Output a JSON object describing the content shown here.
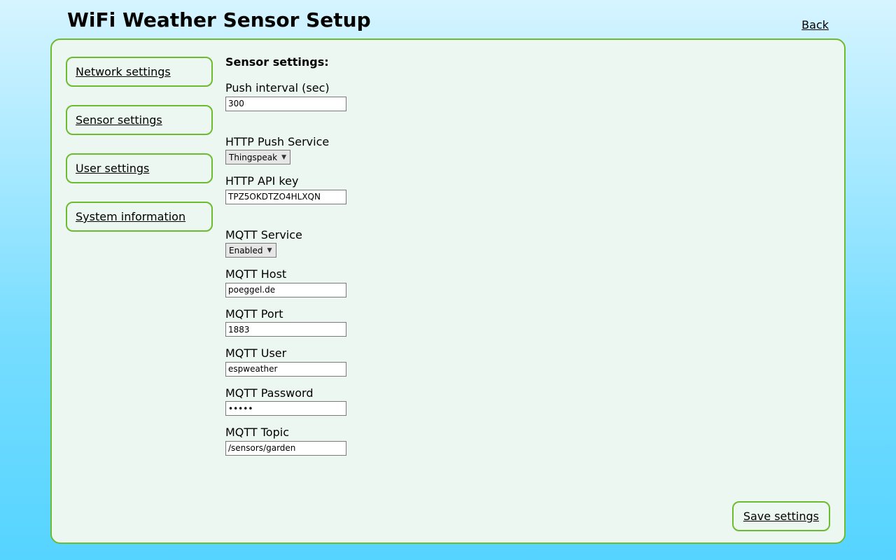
{
  "header": {
    "title": "WiFi Weather Sensor Setup",
    "back_label": "Back"
  },
  "sidebar": {
    "items": [
      {
        "label": "Network settings"
      },
      {
        "label": "Sensor settings"
      },
      {
        "label": "User settings"
      },
      {
        "label": "System information"
      }
    ]
  },
  "content": {
    "heading": "Sensor settings:",
    "fields": {
      "push_interval": {
        "label": "Push interval (sec)",
        "value": "300"
      },
      "http_push_service": {
        "label": "HTTP Push Service",
        "value": "Thingspeak"
      },
      "http_api_key": {
        "label": "HTTP API key",
        "value": "TPZ5OKDTZO4HLXQN"
      },
      "mqtt_service": {
        "label": "MQTT Service",
        "value": "Enabled"
      },
      "mqtt_host": {
        "label": "MQTT Host",
        "value": "poeggel.de"
      },
      "mqtt_port": {
        "label": "MQTT Port",
        "value": "1883"
      },
      "mqtt_user": {
        "label": "MQTT User",
        "value": "espweather"
      },
      "mqtt_password": {
        "label": "MQTT Password",
        "value": "•••••"
      },
      "mqtt_topic": {
        "label": "MQTT Topic",
        "value": "/sensors/garden"
      }
    }
  },
  "actions": {
    "save_label": "Save settings"
  }
}
